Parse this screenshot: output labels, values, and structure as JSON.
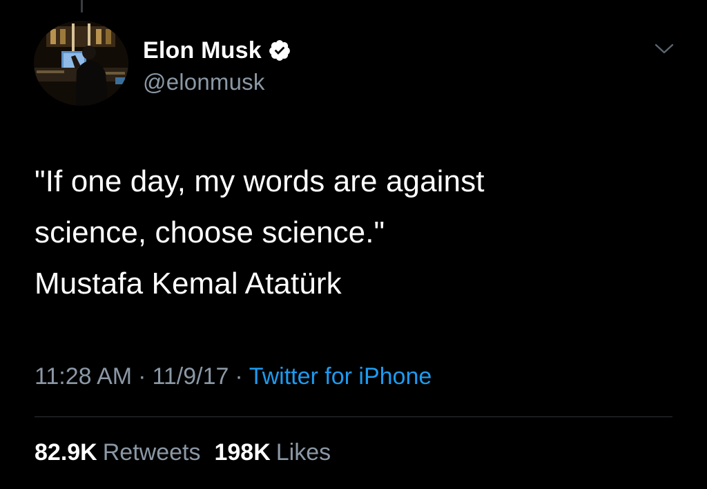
{
  "author": {
    "display_name": "Elon Musk",
    "handle": "@elonmusk",
    "verified": true,
    "avatar_icon": "profile-photo"
  },
  "tweet": {
    "lines": [
      "\"If one day, my words are against",
      "science, choose science.\"",
      "Mustafa Kemal Atatürk"
    ]
  },
  "meta": {
    "time": "11:28 AM",
    "date": "11/9/17",
    "separator": "·",
    "source": "Twitter for iPhone"
  },
  "stats": {
    "retweets_count": "82.9K",
    "retweets_label": "Retweets",
    "likes_count": "198K",
    "likes_label": "Likes"
  },
  "icons": {
    "verified": "verified-badge-icon",
    "menu": "chevron-down-icon"
  },
  "colors": {
    "background": "#000000",
    "primary_text": "#ffffff",
    "secondary_text": "#8b98a5",
    "link": "#1d9bf0",
    "divider": "#2f3336"
  }
}
